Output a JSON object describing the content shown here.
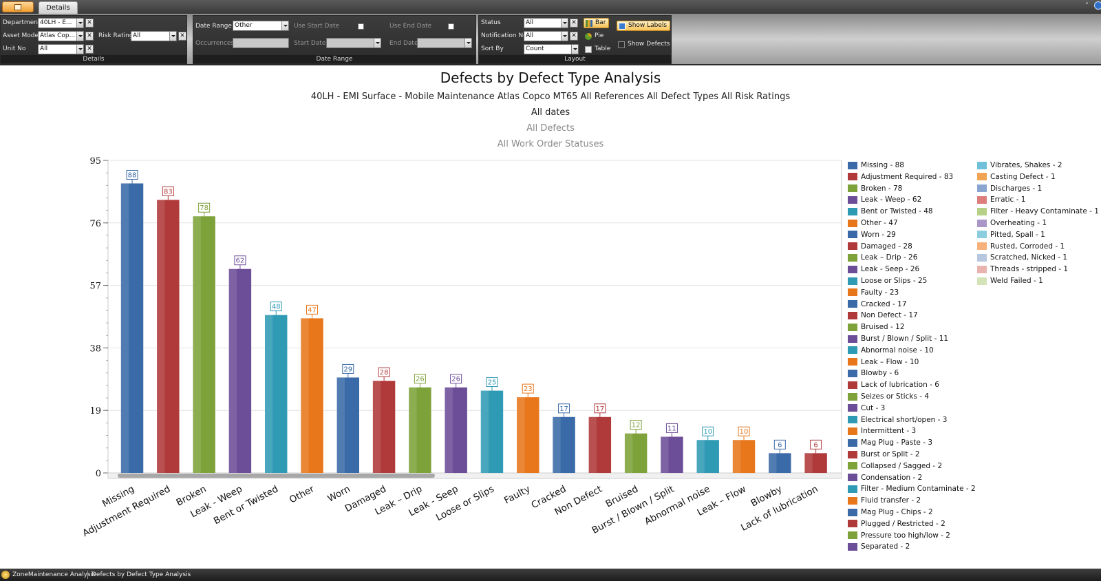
{
  "app": {
    "tab_details": "Details",
    "status_app": "ZoneMaintenance Analysis",
    "status_view": "Defects by Defect Type Analysis"
  },
  "ribbon": {
    "details": {
      "department_label": "Department",
      "department_value": "40LH - E...",
      "asset_model_label": "Asset Model",
      "asset_model_value": "Atlas Cop...",
      "risk_rating_label": "Risk Rating",
      "risk_rating_value": "All",
      "unit_no_label": "Unit No",
      "unit_no_value": "All",
      "group_label": "Details"
    },
    "date_range": {
      "date_range_label": "Date Range",
      "date_range_value": "Other",
      "occurrences_label": "Occurrences",
      "use_start_date_label": "Use Start Date",
      "start_date_label": "Start Date",
      "use_end_date_label": "Use End Date",
      "end_date_label": "End Date",
      "group_label": "Date Range"
    },
    "layout": {
      "status_label": "Status",
      "status_value": "All",
      "notification_no_label": "Notification No",
      "notification_no_value": "All",
      "sort_by_label": "Sort By",
      "sort_by_value": "Count",
      "bar_label": "Bar",
      "pie_label": "Pie",
      "table_label": "Table",
      "show_labels_label": "Show Labels",
      "show_defects_label": "Show Defects",
      "group_label": "Layout"
    }
  },
  "chart": {
    "title": "Defects by Defect Type Analysis",
    "subtitle": "40LH - EMI Surface - Mobile Maintenance Atlas Copco MT65 All References All Defect Types All Risk Ratings",
    "dates": "All dates",
    "defects": "All Defects",
    "statuses": "All Work Order Statuses"
  },
  "chart_data": {
    "type": "bar",
    "categories": [
      "Missing",
      "Adjustment Required",
      "Broken",
      "Leak - Weep",
      "Bent or Twisted",
      "Other",
      "Worn",
      "Damaged",
      "Leak – Drip",
      "Leak - Seep",
      "Loose or Slips",
      "Faulty",
      "Cracked",
      "Non Defect",
      "Bruised",
      "Burst / Blown / Split",
      "Abnormal noise",
      "Leak – Flow",
      "Blowby",
      "Lack of lubrication"
    ],
    "values": [
      88,
      83,
      78,
      62,
      48,
      47,
      29,
      28,
      26,
      26,
      25,
      23,
      17,
      17,
      12,
      11,
      10,
      10,
      6,
      6
    ],
    "ylim": [
      0,
      95
    ],
    "yticks": [
      0,
      19,
      38,
      57,
      76,
      95
    ],
    "grid": true,
    "legend_position": "right",
    "palette": [
      "#3a6aa8",
      "#b0393a",
      "#7ea23a",
      "#6c4d98",
      "#2f9ab4",
      "#e8771c"
    ],
    "legend_light_palette": [
      "#6fc0d8",
      "#f0a352",
      "#8aa6d0",
      "#dc7f7c",
      "#b6d088",
      "#ab96c8",
      "#8ccde0",
      "#f6b27a",
      "#b7c7e0",
      "#e9b3b0",
      "#d4e3b8"
    ],
    "legend": [
      "Missing - 88",
      "Adjustment Required - 83",
      "Broken - 78",
      "Leak - Weep - 62",
      "Bent or Twisted - 48",
      "Other - 47",
      "Worn - 29",
      "Damaged - 28",
      "Leak – Drip - 26",
      "Leak - Seep - 26",
      "Loose or Slips - 25",
      "Faulty - 23",
      "Cracked - 17",
      "Non Defect - 17",
      "Bruised - 12",
      "Burst / Blown / Split - 11",
      "Abnormal noise - 10",
      "Leak – Flow - 10",
      "Blowby - 6",
      "Lack of lubrication - 6",
      "Seizes or Sticks - 4",
      "Cut - 3",
      "Electrical short/open - 3",
      "Intermittent - 3",
      "Mag Plug - Paste - 3",
      "Burst or Split - 2",
      "Collapsed / Sagged - 2",
      "Condensation - 2",
      "Filter - Medium Contaminate - 2",
      "Fluid transfer - 2",
      "Mag Plug - Chips - 2",
      "Plugged / Restricted - 2",
      "Pressure too high/low - 2",
      "Separated - 2",
      "Vibrates, Shakes - 2",
      "Casting Defect - 1",
      "Discharges - 1",
      "Erratic - 1",
      "Filter - Heavy Contaminate - 1",
      "Overheating - 1",
      "Pitted, Spall - 1",
      "Rusted, Corroded - 1",
      "Scratched, Nicked - 1",
      "Threads - stripped - 1",
      "Weld Failed - 1"
    ]
  }
}
